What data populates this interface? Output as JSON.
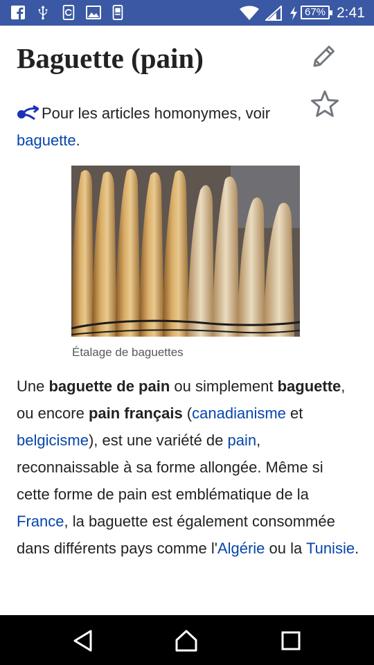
{
  "status_bar": {
    "battery_level": "67%",
    "time": "2:41",
    "icons": [
      "facebook-icon",
      "usb-icon",
      "app-icon",
      "image-icon",
      "phone-icon",
      "wifi-icon",
      "signal-icon",
      "charging-icon",
      "battery-icon"
    ]
  },
  "article": {
    "title": "Baguette (pain)",
    "actions": [
      "edit-icon",
      "star-icon"
    ],
    "hatnote": {
      "text": "Pour les articles homonymes, voir",
      "link": "baguette",
      "suffix": "."
    },
    "figure": {
      "caption": "Étalage de baguettes"
    },
    "paragraph": {
      "p1": "Une ",
      "b1": "baguette de pain",
      "p2": " ou simplement ",
      "b2": "baguette",
      "p3": ", ou encore ",
      "b3": "pain français",
      "p4": " (",
      "l1": "canadianisme",
      "p5": " et ",
      "l2": "belgicisme",
      "p6": "), est une variété de ",
      "l3": "pain",
      "p7": ", reconnaissable à sa forme allongée. Même si cette forme de pain est emblématique de la ",
      "l4": "France",
      "p8": ", la baguette est également consommée dans différents pays comme l'",
      "l5": "Algérie",
      "p9": " ou la ",
      "l6": "Tunisie",
      "p10": "."
    }
  },
  "nav_bar": {
    "buttons": [
      "back-icon",
      "home-icon",
      "recents-icon"
    ]
  },
  "colors": {
    "status_bar": "#3a58a3",
    "link": "#0645ad",
    "text": "#222222",
    "caption": "#54595d",
    "nav_bar": "#000000"
  }
}
